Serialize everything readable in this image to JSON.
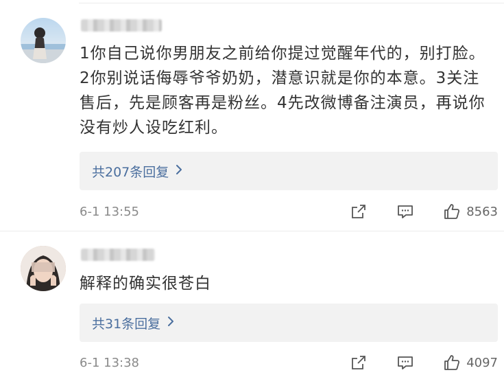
{
  "comments": [
    {
      "text": "1你自己说你男朋友之前给你提过觉醒年代的，别打脸。2你别说话侮辱爷爷奶奶，潜意识就是你的本意。3关注售后，先是顾客再是粉丝。4先改微博备注演员，再说你没有炒人设吃红利。",
      "replies": "共207条回复",
      "time": "6-1 13:55",
      "likes": "8563"
    },
    {
      "text": "解释的确实很苍白",
      "replies": "共31条回复",
      "time": "6-1 13:38",
      "likes": "4097"
    }
  ],
  "icons": {
    "share": "share-icon",
    "comment": "comment-icon",
    "like": "thumbs-up-icon",
    "chevron": "chevron-right-icon"
  },
  "colors": {
    "link": "#4a6e9e",
    "reply_bg": "#f2f2f2",
    "meta_text": "#8a8a8a",
    "icon": "#555555"
  }
}
